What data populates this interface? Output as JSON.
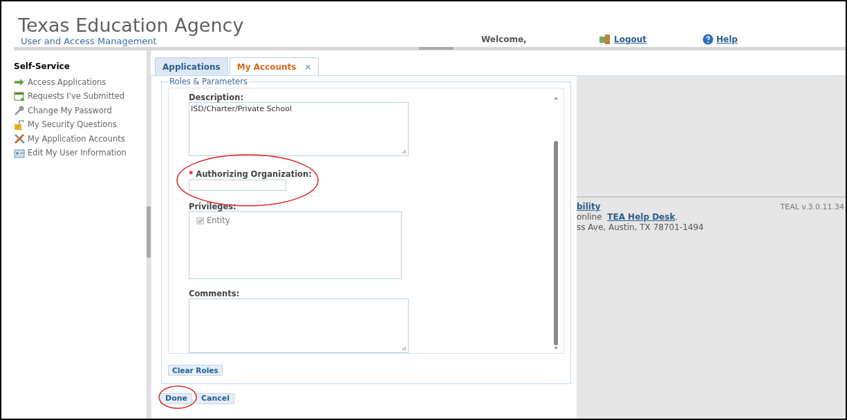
{
  "header": {
    "title": "Texas Education Agency",
    "subtitle": "User and Access Management",
    "welcome": "Welcome,",
    "links": [
      {
        "kind": "logout",
        "label": "Logout"
      },
      {
        "kind": "help",
        "label": "Help"
      }
    ]
  },
  "sidebar": {
    "heading": "Self-Service",
    "items": [
      {
        "kind": "arrow",
        "label": "Access Applications"
      },
      {
        "kind": "requests",
        "label": "Requests I've Submitted"
      },
      {
        "kind": "key",
        "label": "Change My Password"
      },
      {
        "kind": "lock",
        "label": "My Security Questions"
      },
      {
        "kind": "tools",
        "label": "My Application Accounts"
      },
      {
        "kind": "card",
        "label": "Edit My User Information"
      }
    ]
  },
  "tabs": [
    {
      "label": "Applications",
      "selected": false
    },
    {
      "label": "My Accounts",
      "selected": true,
      "close": "×"
    }
  ],
  "form": {
    "legend": "Roles & Parameters",
    "description": {
      "label": "Description:",
      "value": "ISD/Charter/Private School"
    },
    "authorizing_organization": {
      "label": "Authorizing Organization:",
      "required_mark": "*"
    },
    "privileges": {
      "label": "Privileges:",
      "items": [
        {
          "label": "Entity",
          "checked": true,
          "disabled": true
        }
      ]
    },
    "comments": {
      "label": "Comments:"
    },
    "clear_button": "Clear Roles"
  },
  "buttons": [
    "Done",
    "Cancel"
  ],
  "footer": {
    "heading": "bility",
    "line_1_prefix": "online ",
    "line_1_link": "TEA Help Desk",
    "line_1_suffix": ".",
    "line_2": "ss Ave, Austin, TX 78701-1494",
    "version": "TEAL v.3.0.11.34"
  }
}
